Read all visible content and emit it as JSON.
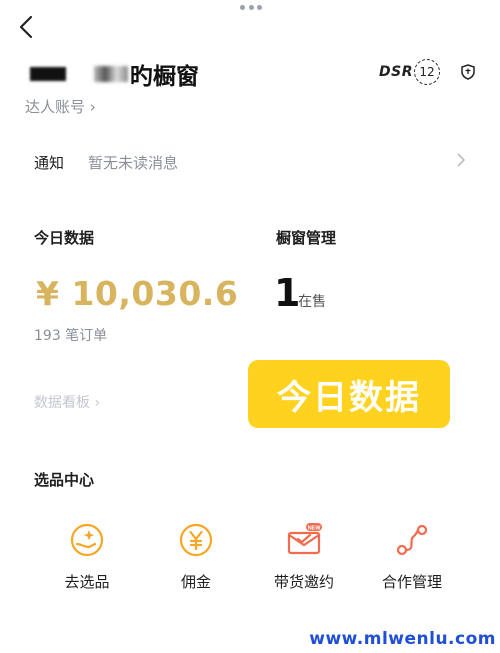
{
  "header": {
    "title_suffix": "旳橱窗",
    "account_link": "达人账号 ›",
    "dsr_label": "DSR",
    "level_badge": "12"
  },
  "notice": {
    "label": "通知",
    "message": "暂无未读消息"
  },
  "today": {
    "title": "今日数据",
    "amount": "¥ 10,030.6",
    "orders": "193 笔订单",
    "board_link": "数据看板 ›"
  },
  "window_mgmt": {
    "title": "橱窗管理",
    "count": "1",
    "count_suffix": "在售"
  },
  "overlay_caption": "今日数据",
  "selection_center": {
    "title": "选品中心",
    "items": [
      {
        "label": "去选品",
        "icon": "hand-star-icon"
      },
      {
        "label": "佣金",
        "icon": "yen-coin-icon"
      },
      {
        "label": "带货邀约",
        "icon": "mail-new-icon"
      },
      {
        "label": "合作管理",
        "icon": "route-icon"
      }
    ]
  },
  "watermark": "www.mlwenlu.com",
  "colors": {
    "accent_orange": "#f5a623",
    "accent_red": "#f26b4f",
    "amount_gold": "#d9b45f",
    "overlay_yellow": "#ffd21f"
  }
}
